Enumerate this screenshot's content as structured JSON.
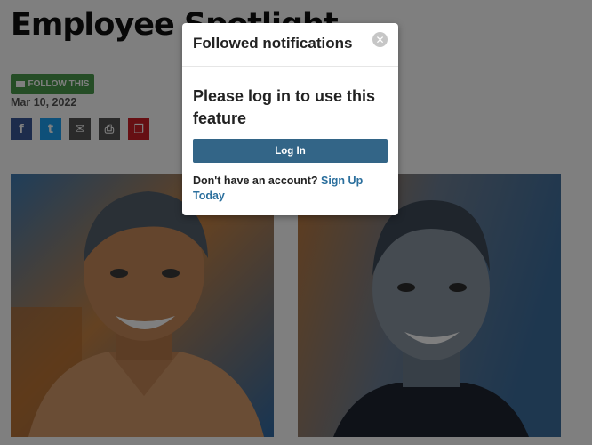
{
  "article": {
    "title": "Employee Spotlight",
    "follow_label": "FOLLOW THIS",
    "date": "Mar 10, 2022",
    "share_buttons": [
      {
        "name": "facebook-icon",
        "glyph": "f",
        "color": "#3b5998"
      },
      {
        "name": "twitter-icon",
        "glyph": "t",
        "color": "#1da1f2"
      },
      {
        "name": "email-icon",
        "glyph": "✉",
        "color": "#555555"
      },
      {
        "name": "print-icon",
        "glyph": "⎙",
        "color": "#555555"
      },
      {
        "name": "bookmark-icon",
        "glyph": "❐",
        "color": "#cc1f27"
      }
    ]
  },
  "modal": {
    "title": "Followed notifications",
    "close_icon": "close-icon",
    "heading": "Please log in to use this feature",
    "login_label": "Log In",
    "prompt": "Don't have an account?",
    "signup_link": "Sign Up Today"
  },
  "colors": {
    "follow_green": "#4b9a4d",
    "login_blue": "#336587",
    "link_blue": "#2b6f9d",
    "overlay": "rgba(0,0,0,0.5)"
  }
}
